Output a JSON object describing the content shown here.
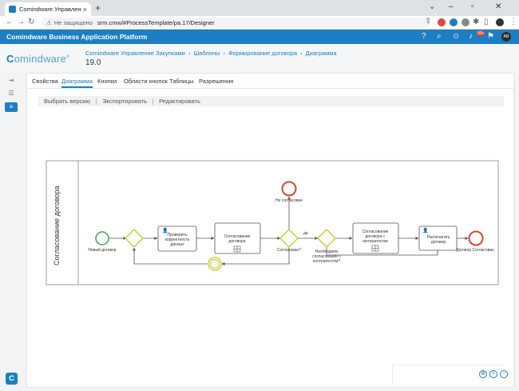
{
  "browser": {
    "tab_title": "Comindware Управление Закуп",
    "address_warning": "Не защищено",
    "url": "srm.cmw/#ProcessTemplate/pa.17/Designer"
  },
  "app": {
    "title": "Comindware Business Application Platform",
    "notification_badge": "99+",
    "avatar_initials": "AB"
  },
  "page": {
    "logo_first": "C",
    "logo_rest": "omindware",
    "logo_mark": "®",
    "breadcrumbs": [
      "Comindware Управление Закупками",
      "Шаблоны",
      "Формирование договора",
      "Диаграмма"
    ],
    "version": "19.0"
  },
  "tabs": [
    "Свойства",
    "Диаграмма",
    "Кнопки",
    "Области кнопок",
    "Таблицы",
    "Разрешения"
  ],
  "toolbar": [
    "Выбрать версию",
    "Экспортировать",
    "Редактировать"
  ],
  "diagram": {
    "pool_name": "Согласование договора",
    "start_label": "Новый договор",
    "task_check": [
      "Проверить",
      "корректность",
      "данных"
    ],
    "task_approve": [
      "Согласование",
      "договора"
    ],
    "task_counterparty": [
      "Согласование",
      "договора с",
      "контрагентом"
    ],
    "task_print": [
      "Распечатать",
      "договор"
    ],
    "gateway_approved": "Согласован?",
    "gateway_counterparty": [
      "Необходимо",
      "согласование с",
      "контрагентом?"
    ],
    "flow_yes": "да",
    "end_rejected": "Не согласован",
    "end_approved": "Договор Согласован"
  }
}
